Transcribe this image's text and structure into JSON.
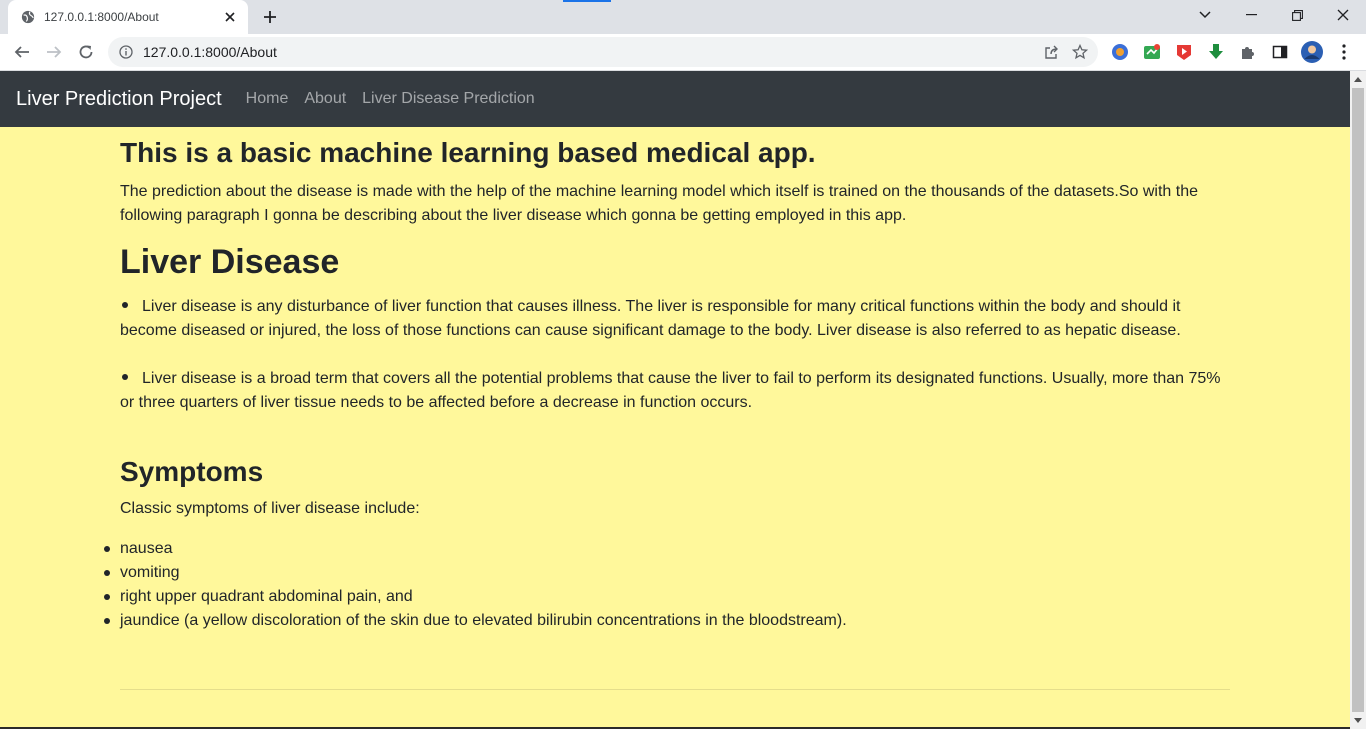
{
  "browser": {
    "tab_title": "127.0.0.1:8000/About",
    "url": "127.0.0.1:8000/About",
    "accent_color": "#1a73e8"
  },
  "navbar": {
    "brand": "Liver Prediction Project",
    "links": [
      "Home",
      "About",
      "Liver Disease Prediction"
    ],
    "background": "#343a40"
  },
  "page": {
    "background": "#fff89b",
    "intro_heading": "This is a basic machine learning based medical app.",
    "intro_text": "The prediction about the disease is made with the help of the machine learning model which itself is trained on the thousands of the datasets.So with the following paragraph I gonna be describing about the liver disease which gonna be getting employed in this app.",
    "disease_heading": "Liver Disease",
    "disease_points": [
      "Liver disease is any disturbance of liver function that causes illness. The liver is responsible for many critical functions within the body and should it become diseased or injured, the loss of those functions can cause significant damage to the body. Liver disease is also referred to as hepatic disease.",
      "Liver disease is a broad term that covers all the potential problems that cause the liver to fail to perform its designated functions. Usually, more than 75% or three quarters of liver tissue needs to be affected before a decrease in function occurs."
    ],
    "symptoms_heading": "Symptoms",
    "symptoms_intro": "Classic symptoms of liver disease include:",
    "symptoms": [
      "nausea",
      "vomiting",
      "right upper quadrant abdominal pain, and",
      "jaundice (a yellow discoloration of the skin due to elevated bilirubin concentrations in the bloodstream)."
    ]
  }
}
